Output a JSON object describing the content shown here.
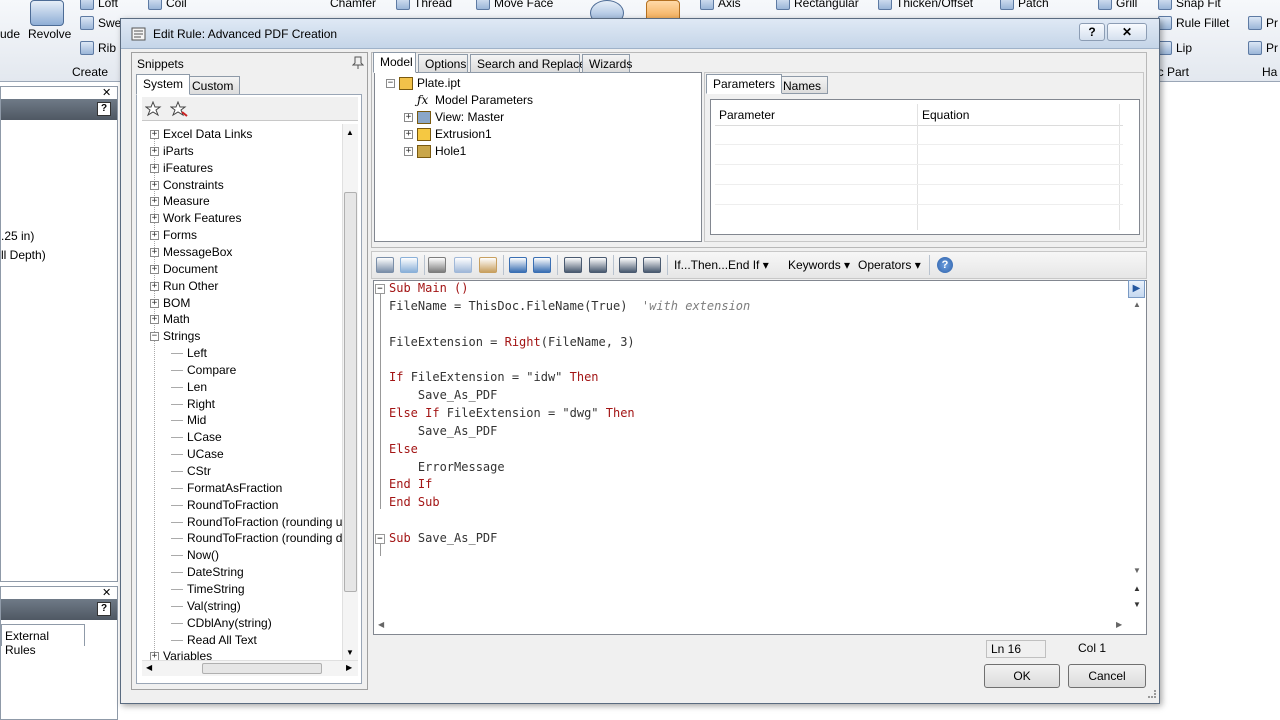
{
  "ribbon": {
    "items": [
      "Loft",
      "Revolve",
      "Swe",
      "Rib",
      "Coil",
      "Chamfer",
      "Thread",
      "Move Face",
      "Axis",
      "Rectangular",
      "Thicken/Offset",
      "Patch",
      "Grill",
      "Snap Fit",
      "Rule Fillet",
      "Lip"
    ],
    "extrude_partial": "ude",
    "create_label": "Create",
    "plastic_part_label": "ic Part",
    "harness_label": "Ha",
    "pr_labels": [
      "Pr",
      "Pr"
    ]
  },
  "left_bg": {
    "depth_line1": ".25 in)",
    "depth_line2": "ll Depth)",
    "external_rules_tab": "External Rules"
  },
  "dialog": {
    "title": "Edit Rule: Advanced PDF Creation",
    "help_btn": "?",
    "close_btn": "✕"
  },
  "snippets": {
    "header": "Snippets",
    "tabs": [
      "System",
      "Custom"
    ],
    "tree": [
      {
        "label": "Excel Data Links",
        "expander": "+"
      },
      {
        "label": "iParts",
        "expander": "+"
      },
      {
        "label": "iFeatures",
        "expander": "+"
      },
      {
        "label": "Constraints",
        "expander": "+"
      },
      {
        "label": "Measure",
        "expander": "+"
      },
      {
        "label": "Work Features",
        "expander": "+"
      },
      {
        "label": "Forms",
        "expander": "+"
      },
      {
        "label": "MessageBox",
        "expander": "+"
      },
      {
        "label": "Document",
        "expander": "+"
      },
      {
        "label": "Run Other",
        "expander": "+"
      },
      {
        "label": "BOM",
        "expander": "+"
      },
      {
        "label": "Math",
        "expander": "+"
      },
      {
        "label": "Strings",
        "expander": "−"
      }
    ],
    "string_children": [
      "Left",
      "Compare",
      "Len",
      "Right",
      "Mid",
      "LCase",
      "UCase",
      "CStr",
      "FormatAsFraction",
      "RoundToFraction",
      "RoundToFraction (rounding up",
      "RoundToFraction (rounding do",
      "Now()",
      "DateString",
      "TimeString",
      "Val(string)",
      "CDblAny(string)",
      "Read All Text"
    ],
    "after": {
      "label": "Variables",
      "expander": "+"
    }
  },
  "model_tabs": [
    "Model",
    "Options",
    "Search and Replace",
    "Wizards"
  ],
  "model_tree": [
    {
      "label": "Plate.ipt",
      "expander": "−"
    },
    {
      "label": "Model Parameters",
      "expander": ""
    },
    {
      "label": "View: Master",
      "expander": "+"
    },
    {
      "label": "Extrusion1",
      "expander": "+"
    },
    {
      "label": "Hole1",
      "expander": "+"
    }
  ],
  "param_tabs": [
    "Parameters",
    "Names"
  ],
  "param_columns": [
    "Parameter",
    "Equation"
  ],
  "editor_toolbar": {
    "dropdowns": [
      "If...Then...End If",
      "Keywords",
      "Operators"
    ],
    "help_icon": "?"
  },
  "code": [
    [
      {
        "t": "Sub Main ()",
        "c": "kw"
      }
    ],
    [
      {
        "t": "FileName = ",
        "c": "id"
      },
      {
        "t": "ThisDoc.FileName",
        "c": "id"
      },
      {
        "t": "(True)  ",
        "c": "id"
      },
      {
        "t": "'with extension",
        "c": "cmt"
      }
    ],
    [],
    [
      {
        "t": "FileExtension = ",
        "c": "id"
      },
      {
        "t": "Right",
        "c": "kw"
      },
      {
        "t": "(FileName, 3)",
        "c": "id"
      }
    ],
    [],
    [
      {
        "t": "If ",
        "c": "kw"
      },
      {
        "t": "FileExtension = ",
        "c": "id"
      },
      {
        "t": "\"idw\"",
        "c": "str"
      },
      {
        "t": " Then",
        "c": "kw"
      }
    ],
    [
      {
        "t": "    Save_As_PDF",
        "c": "id"
      }
    ],
    [
      {
        "t": "Else If ",
        "c": "kw"
      },
      {
        "t": "FileExtension = ",
        "c": "id"
      },
      {
        "t": "\"dwg\"",
        "c": "str"
      },
      {
        "t": " Then",
        "c": "kw"
      }
    ],
    [
      {
        "t": "    Save_As_PDF",
        "c": "id"
      }
    ],
    [
      {
        "t": "Else",
        "c": "kw"
      }
    ],
    [
      {
        "t": "    ErrorMessage",
        "c": "id"
      }
    ],
    [
      {
        "t": "End If",
        "c": "kw"
      }
    ],
    [
      {
        "t": "End Sub",
        "c": "kw"
      }
    ],
    [],
    [
      {
        "t": "Sub ",
        "c": "kw"
      },
      {
        "t": "Save_As_PDF",
        "c": "id"
      }
    ],
    []
  ],
  "status": {
    "line": "Ln 16",
    "col": "Col 1"
  },
  "buttons": {
    "ok": "OK",
    "cancel": "Cancel"
  },
  "colors": {
    "keyword": "#a31515",
    "comment": "#7d7d7d",
    "accent": "#3a6fb3"
  }
}
